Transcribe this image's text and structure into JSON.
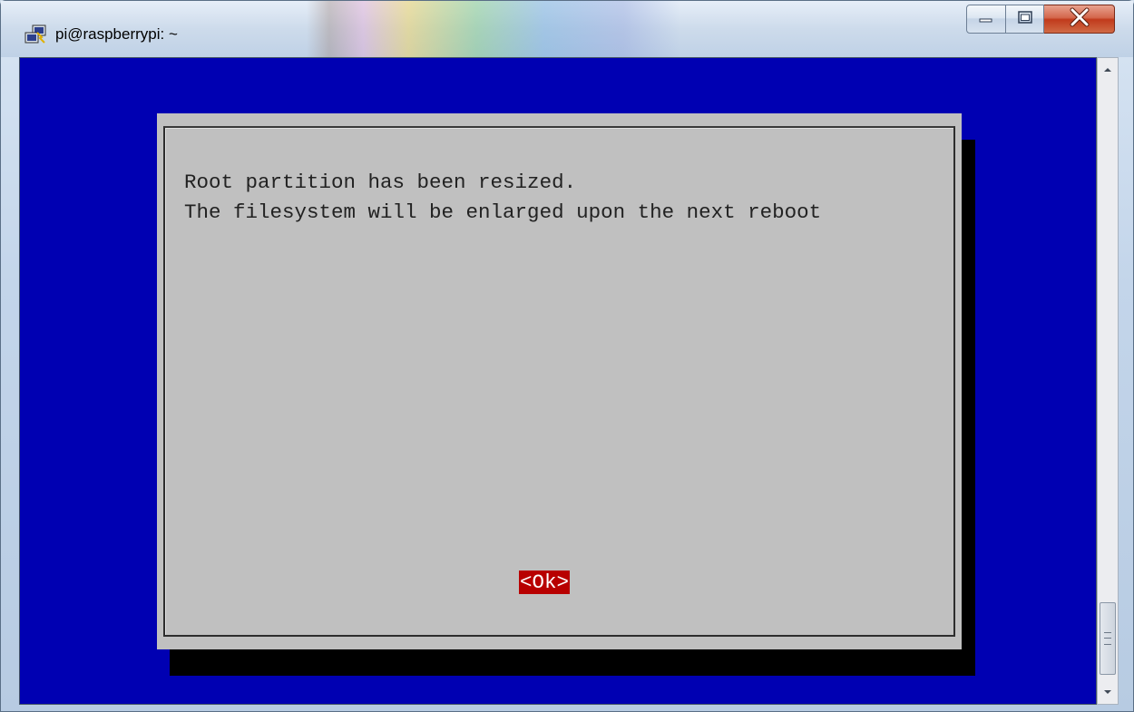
{
  "window": {
    "title": "pi@raspberrypi: ~",
    "app_icon": "putty-icon",
    "controls": [
      "minimize-icon",
      "maximize-icon",
      "close-icon"
    ]
  },
  "dialog": {
    "lines": [
      "Root partition has been resized.",
      "The filesystem will be enlarged upon the next reboot"
    ],
    "ok_label": "<Ok>"
  },
  "colors": {
    "terminal_bg": "#0000b2",
    "dialog_bg": "#c0c0c0",
    "button_bg": "#b80000",
    "button_fg": "#ffffff"
  }
}
